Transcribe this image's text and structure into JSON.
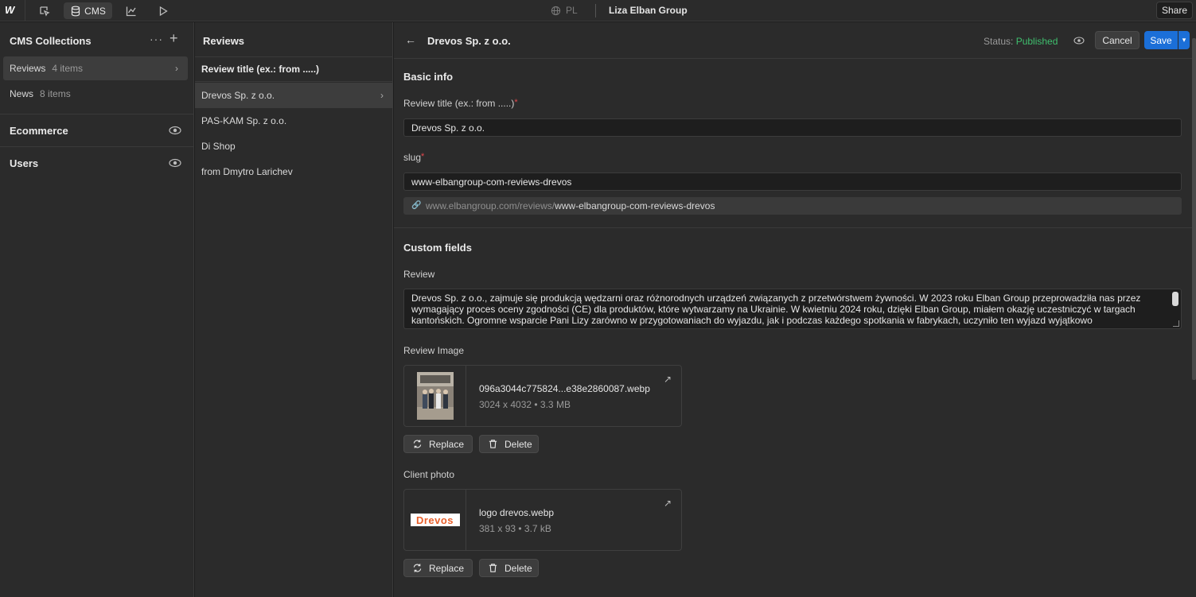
{
  "topbar": {
    "logo": "W",
    "cms_label": "CMS",
    "locale": "PL",
    "site_name": "Liza Elban Group",
    "share_label": "Share"
  },
  "left_panel": {
    "title": "CMS Collections",
    "collections": [
      {
        "name": "Reviews",
        "count": "4 items"
      },
      {
        "name": "News",
        "count": "8 items"
      }
    ],
    "sections": [
      "Ecommerce",
      "Users"
    ]
  },
  "middle_panel": {
    "title": "Reviews",
    "column_header": "Review title (ex.: from .....)",
    "items": [
      "Drevos Sp. z o.o.",
      "PAS-KAM Sp. z o.o.",
      "Di Shop",
      "from Dmytro Larichev"
    ]
  },
  "editor": {
    "title": "Drevos Sp. z o.o.",
    "status_label": "Status:",
    "status_value": "Published",
    "cancel_label": "Cancel",
    "save_label": "Save",
    "basic_info_title": "Basic info",
    "review_title_label": "Review title (ex.: from .....)",
    "review_title_value": "Drevos Sp. z o.o.",
    "slug_label": "slug",
    "slug_value": "www-elbangroup-com-reviews-drevos",
    "url_prefix": "www.elbangroup.com/reviews/",
    "url_slug": "www-elbangroup-com-reviews-drevos",
    "custom_fields_title": "Custom fields",
    "review_label": "Review",
    "review_text": "Drevos Sp. z o.o., zajmuje się produkcją wędzarni oraz różnorodnych urządzeń związanych z przetwórstwem żywności. W 2023 roku Elban Group przeprowadziła nas przez wymagający proces oceny zgodności (CE) dla produktów, które wytwarzamy na Ukrainie. W kwietniu 2024 roku, dzięki Elban Group, miałem okazję uczestniczyć w targach kantońskich. Ogromne wsparcie Pani Lizy zarówno w przygotowaniach do wyjazdu, jak i podczas każdego spotkania w fabrykach, uczyniło ten wyjazd wyjątkowo",
    "review_image_label": "Review Image",
    "review_image": {
      "filename": "096a3044c775824...e38e2860087.webp",
      "meta": "3024 x 4032 • 3.3 MB"
    },
    "client_photo_label": "Client photo",
    "client_photo": {
      "filename": "logo drevos.webp",
      "meta": "381 x 93 • 3.7 kB",
      "logo_text": "Drevos"
    },
    "replace_label": "Replace",
    "delete_label": "Delete"
  },
  "colors": {
    "accent": "#1b6fd8",
    "published": "#3fbf6e",
    "required": "#e5484d",
    "logo_orange": "#e8602c"
  }
}
